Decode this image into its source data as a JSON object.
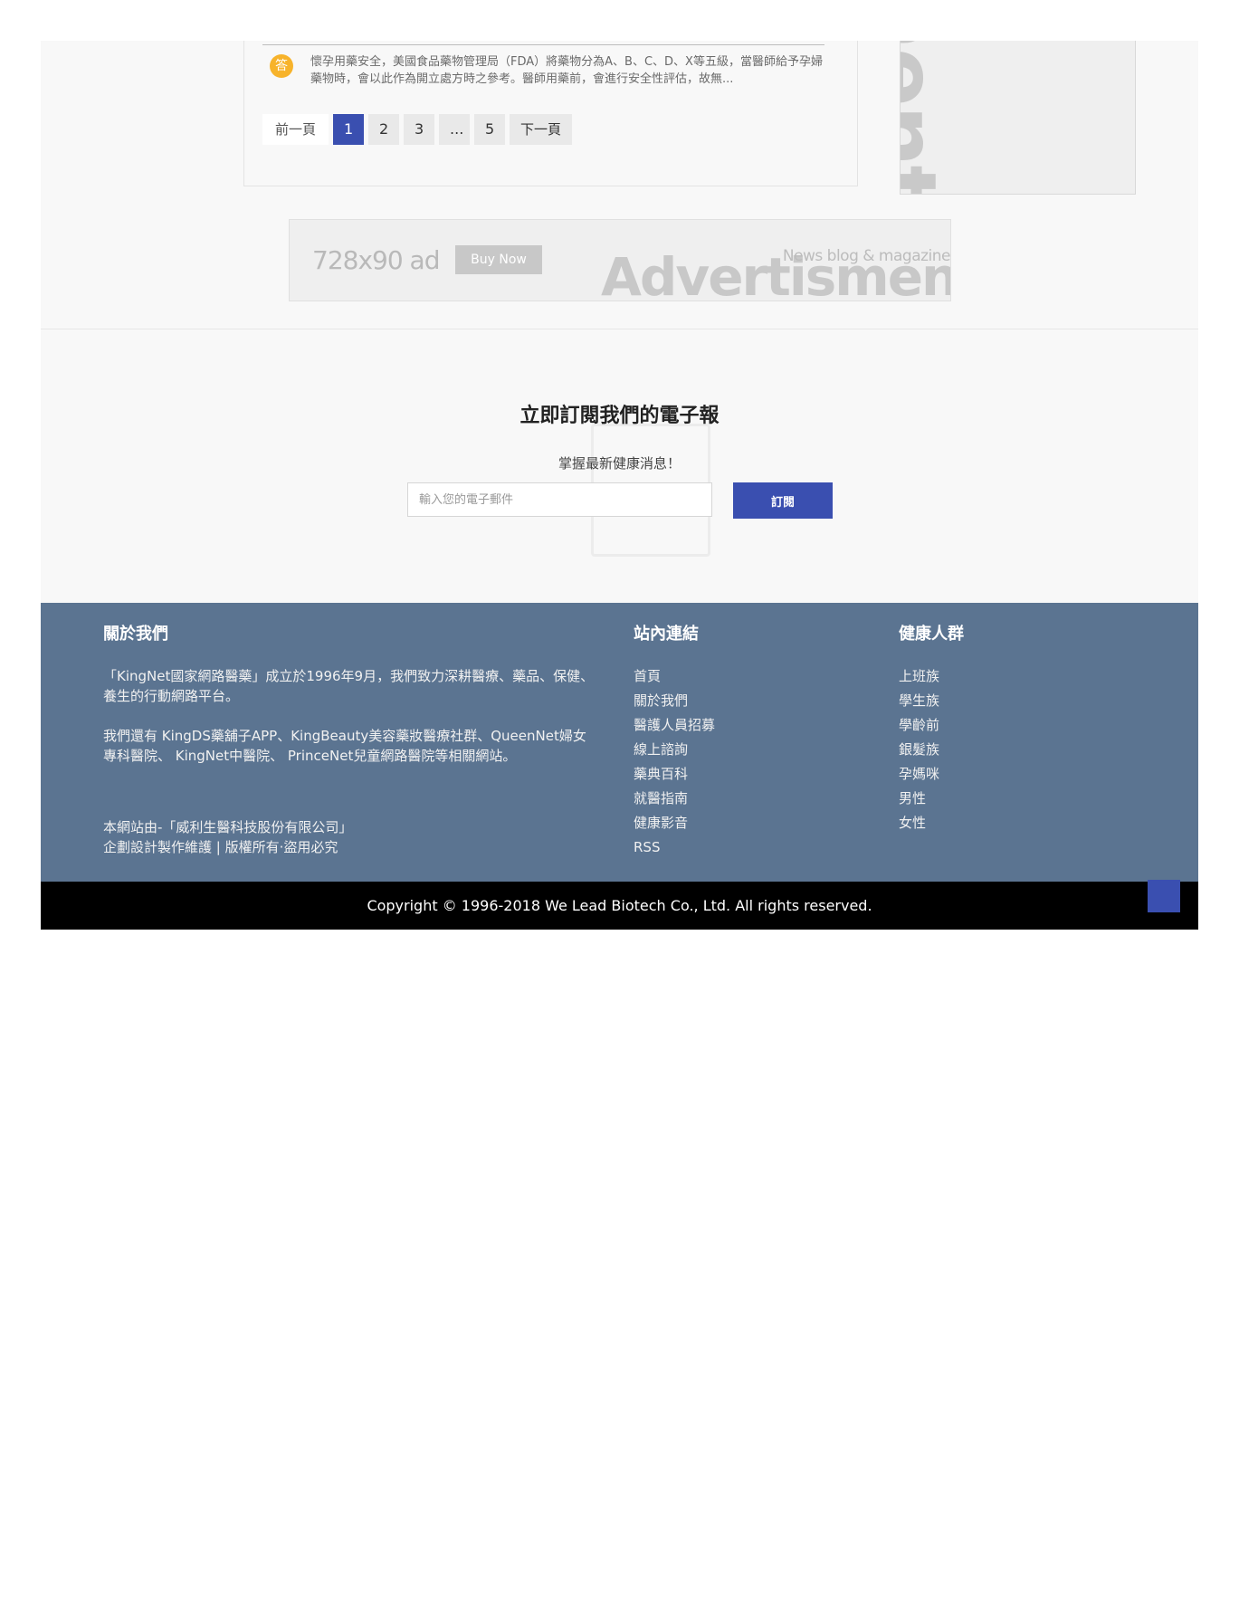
{
  "qa": {
    "badge": "答",
    "answer_text": "懷孕用藥安全，美國食品藥物管理局（FDA）將藥物分為A、B、C、D、X等五級，當醫師給予孕婦藥物時，會以此作為開立處方時之參考。醫師用藥前，會進行安全性評估，故無..."
  },
  "pagination": {
    "prev_label": "前一頁",
    "pages": [
      "1",
      "2",
      "3",
      "...",
      "5"
    ],
    "current": "1",
    "next_label": "下一頁"
  },
  "side_ad": {
    "word": "ment"
  },
  "banner_ad": {
    "size_label": "728x90 ad",
    "button_label": "Buy Now",
    "tagline": "News blog & magazine",
    "word": "Advertisment"
  },
  "newsletter": {
    "title": "立即訂閱我們的電子報",
    "subtitle": "掌握最新健康消息！",
    "placeholder": "輸入您的電子郵件",
    "button_label": "訂閱"
  },
  "footer": {
    "about": {
      "heading": "關於我們",
      "para1": "「KingNet國家網路醫藥」成立於1996年9月，我們致力深耕醫療、藥品、保健、養生的行動網路平台。",
      "para2": "我們還有 KingDS藥舖子APP、KingBeauty美容藥妝醫療社群、QueenNet婦女專科醫院、 KingNet中醫院、 PrinceNet兒童網路醫院等相關網站。",
      "legal_line1": "本網站由-「威利生醫科技股份有限公司」",
      "legal_line2": "企劃設計製作維護 | 版權所有‧盜用必究"
    },
    "links": {
      "heading": "站內連結",
      "items": [
        "首頁",
        "關於我們",
        "醫護人員招募",
        "線上諮詢",
        "藥典百科",
        "就醫指南",
        "健康影音",
        "RSS"
      ]
    },
    "groups": {
      "heading": "健康人群",
      "items": [
        "上班族",
        "學生族",
        "學齡前",
        "銀髮族",
        "孕媽咪",
        "男性",
        "女性"
      ]
    }
  },
  "copyright": "Copyright © 1996-2018 We Lead Biotech Co., Ltd. All rights reserved.",
  "colors": {
    "accent": "#3a4fb0",
    "footer_bg": "#5b7491",
    "copyright_bg": "#000000",
    "badge": "#f7b32b"
  }
}
